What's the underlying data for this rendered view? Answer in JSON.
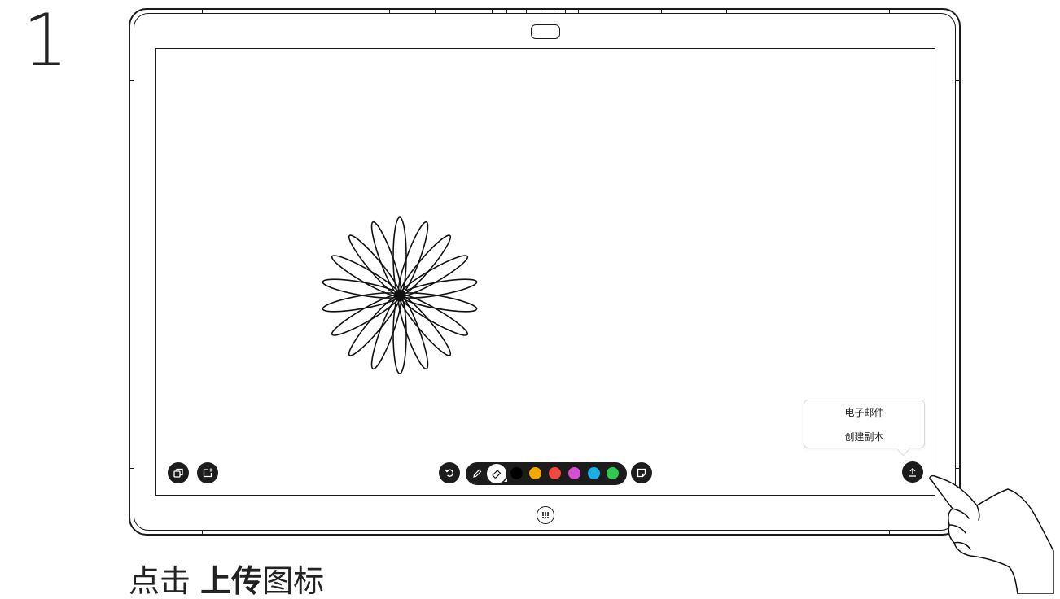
{
  "step": {
    "number": "1"
  },
  "device": {
    "name": "whiteboard-device"
  },
  "toolbar": {
    "left_buttons": [
      {
        "name": "switch-board-button",
        "icon": "pages-icon"
      },
      {
        "name": "new-board-button",
        "icon": "add-page-icon"
      }
    ],
    "undo_icon": "undo-icon",
    "pen_icon": "pen-icon",
    "eraser_icon": "eraser-icon",
    "colors": [
      "#000000",
      "#f5a800",
      "#f2493d",
      "#d64fd1",
      "#1aaee5",
      "#2ec952"
    ],
    "sticky_note_icon": "sticky-note-icon",
    "upload_icon": "upload-icon"
  },
  "upload_menu": {
    "items": [
      {
        "label": "电子邮件"
      },
      {
        "label": "创建副本"
      }
    ]
  },
  "caption": {
    "prefix": "点击 ",
    "emphasis": "上传",
    "suffix": "图标"
  }
}
